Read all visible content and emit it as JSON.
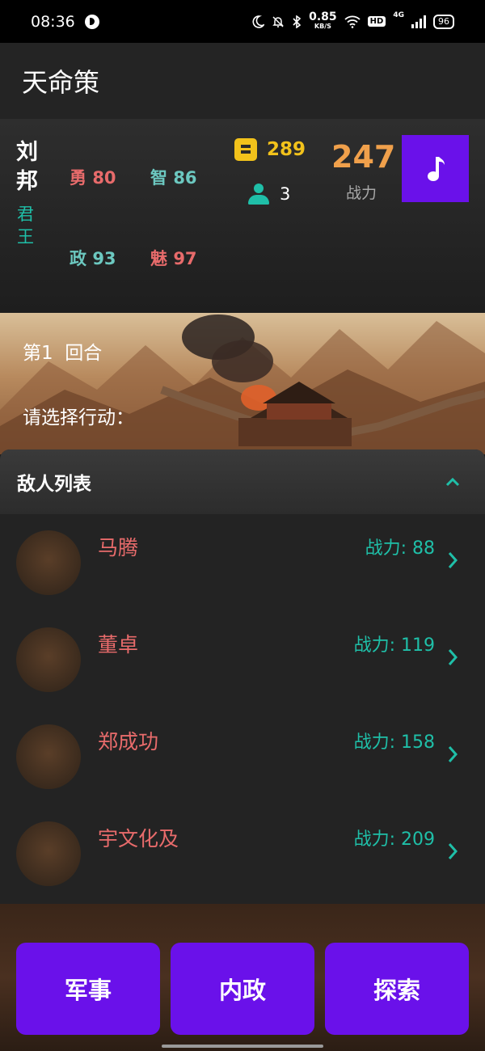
{
  "status_bar": {
    "time": "08:36",
    "net_speed": "0.85",
    "net_unit": "KB/S",
    "hd": "HD",
    "network": "4G",
    "battery": "96"
  },
  "app": {
    "title": "天命策"
  },
  "profile": {
    "name": "刘邦",
    "rank": "君王",
    "stats": {
      "courage": {
        "label": "勇",
        "value": "80"
      },
      "wisdom": {
        "label": "智",
        "value": "86"
      },
      "politics": {
        "label": "政",
        "value": "93"
      },
      "charm": {
        "label": "魅",
        "value": "97"
      }
    },
    "gold": "289",
    "population": "3",
    "power": "247",
    "power_label": "战力"
  },
  "banner": {
    "turn": "第1  回合",
    "prompt": "请选择行动："
  },
  "enemies": {
    "title": "敌人列表",
    "power_label": "战力: ",
    "items": [
      {
        "name": "马腾",
        "power": "88"
      },
      {
        "name": "董卓",
        "power": "119"
      },
      {
        "name": "郑成功",
        "power": "158"
      },
      {
        "name": "宇文化及",
        "power": "209"
      }
    ]
  },
  "actions": {
    "military": "军事",
    "domestic": "内政",
    "explore": "探索"
  },
  "colors": {
    "accent_purple": "#6a11ea",
    "teal": "#1fbfa8",
    "gold": "#f2c21b",
    "enemy_red": "#e86b6b",
    "power_orange": "#f0a04b"
  },
  "icons": [
    "moon-icon",
    "mute-icon",
    "bluetooth-icon",
    "wifi-icon",
    "signal-icon",
    "battery-icon",
    "gold-icon",
    "person-icon",
    "music-note-icon",
    "chevron-up-icon",
    "chevron-right-icon"
  ]
}
